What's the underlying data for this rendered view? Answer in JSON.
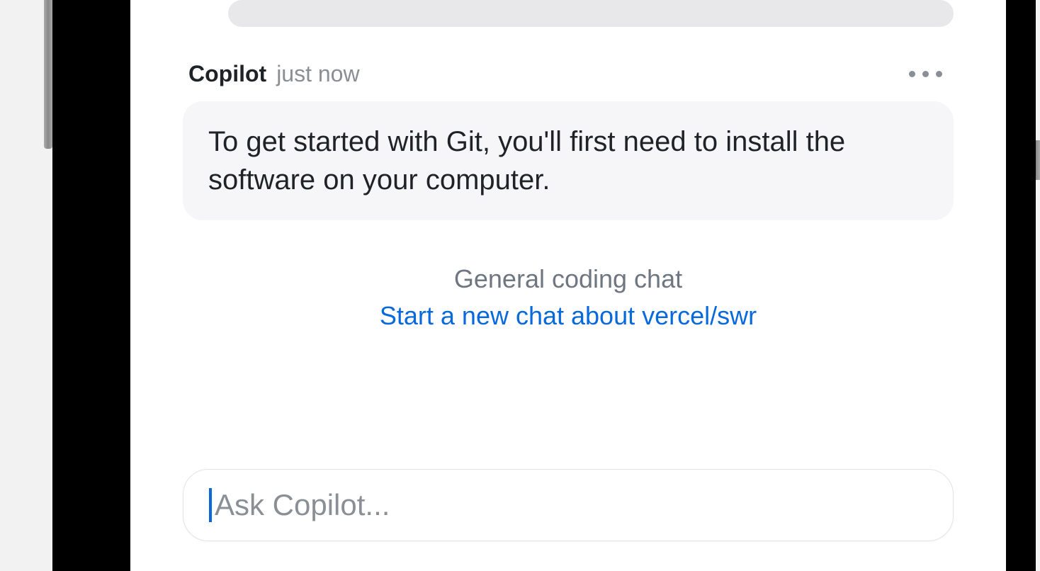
{
  "message": {
    "sender": "Copilot",
    "timestamp": "just now",
    "text": "To get started with Git, you'll first need to install the software on your computer."
  },
  "footer": {
    "chat_type": "General coding chat",
    "new_chat_link": "Start a new chat about vercel/swr"
  },
  "input": {
    "placeholder": "Ask Copilot..."
  }
}
